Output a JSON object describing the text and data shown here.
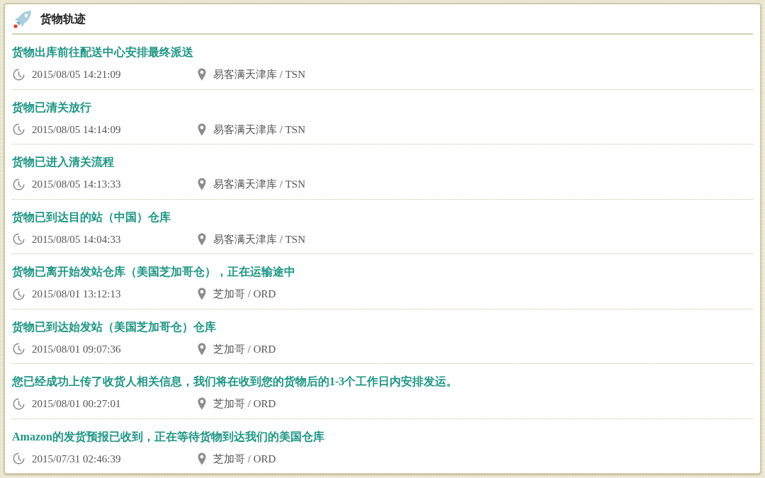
{
  "panel": {
    "title": "货物轨迹"
  },
  "events": [
    {
      "description": "货物出库前往配送中心安排最终派送",
      "time": "2015/08/05 14:21:09",
      "location": "易客满天津库 / TSN"
    },
    {
      "description": "货物已清关放行",
      "time": "2015/08/05 14:14:09",
      "location": "易客满天津库 / TSN"
    },
    {
      "description": "货物已进入清关流程",
      "time": "2015/08/05 14:13:33",
      "location": "易客满天津库 / TSN"
    },
    {
      "description": "货物已到达目的站（中国）仓库",
      "time": "2015/08/05 14:04:33",
      "location": "易客满天津库 / TSN"
    },
    {
      "description": "货物已离开始发站仓库（美国芝加哥仓），正在运输途中",
      "time": "2015/08/01 13:12:13",
      "location": "芝加哥 / ORD"
    },
    {
      "description": "货物已到达始发站（美国芝加哥仓）仓库",
      "time": "2015/08/01 09:07:36",
      "location": "芝加哥 / ORD"
    },
    {
      "description": "您已经成功上传了收货人相关信息，我们将在收到您的货物后的1-3个工作日内安排发运。",
      "time": "2015/08/01 00:27:01",
      "location": "芝加哥 / ORD"
    },
    {
      "description": "Amazon的发货预报已收到，正在等待货物到达我们的美国仓库",
      "time": "2015/07/31 02:46:39",
      "location": "芝加哥 / ORD"
    }
  ]
}
